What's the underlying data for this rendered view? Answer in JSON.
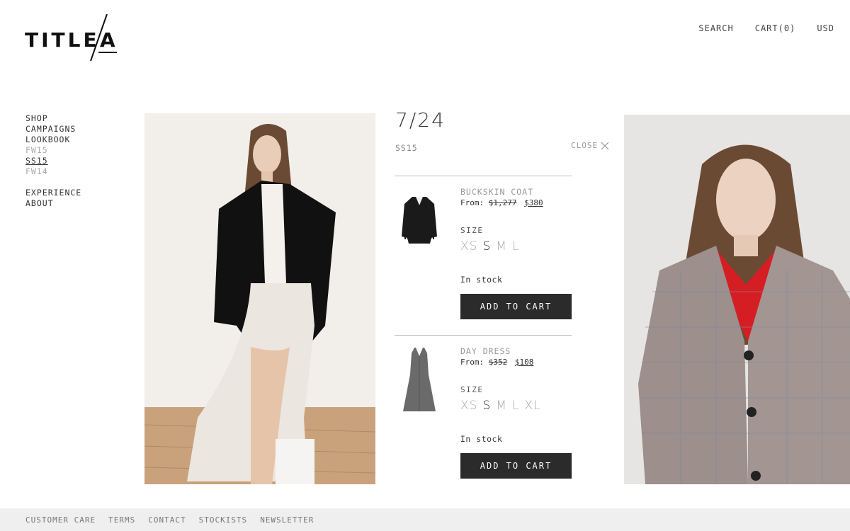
{
  "brand": {
    "logo_text": "TITLE A"
  },
  "topnav": {
    "search": "SEARCH",
    "cart": "CART(0)",
    "currency": "USD"
  },
  "sidenav": {
    "shop": "SHOP",
    "campaigns": "CAMPAIGNS",
    "lookbook": "LOOKBOOK",
    "fw15": "FW15",
    "ss15": "SS15",
    "fw14": "FW14",
    "experience": "EXPERIENCE",
    "about": "ABOUT"
  },
  "look": {
    "counter": "7/24",
    "season": "SS15",
    "close_label": "CLOSE"
  },
  "products": [
    {
      "name": "BUCKSKIN COAT",
      "from_label": "From:",
      "old_price": "$1,277",
      "new_price": "$380",
      "size_label": "SIZE",
      "sizes": [
        "XS",
        "S",
        "M",
        "L"
      ],
      "selected_size": "S",
      "stock": "In stock",
      "button": "ADD TO CART",
      "thumb_icon": "jacket-thumbnail"
    },
    {
      "name": "DAY DRESS",
      "from_label": "From:",
      "old_price": "$352",
      "new_price": "$108",
      "size_label": "SIZE",
      "sizes": [
        "XS",
        "S",
        "M",
        "L",
        "XL"
      ],
      "selected_size": "S",
      "stock": "In stock",
      "button": "ADD TO CART",
      "thumb_icon": "dress-thumbnail"
    }
  ],
  "footer": {
    "customer_care": "CUSTOMER CARE",
    "terms": "TERMS",
    "contact": "CONTACT",
    "stockists": "STOCKISTS",
    "newsletter": "NEWSLETTER"
  },
  "colors": {
    "button_bg": "#2b2b2b",
    "footer_bg": "#efefef",
    "muted_text": "#aaaaaa"
  }
}
